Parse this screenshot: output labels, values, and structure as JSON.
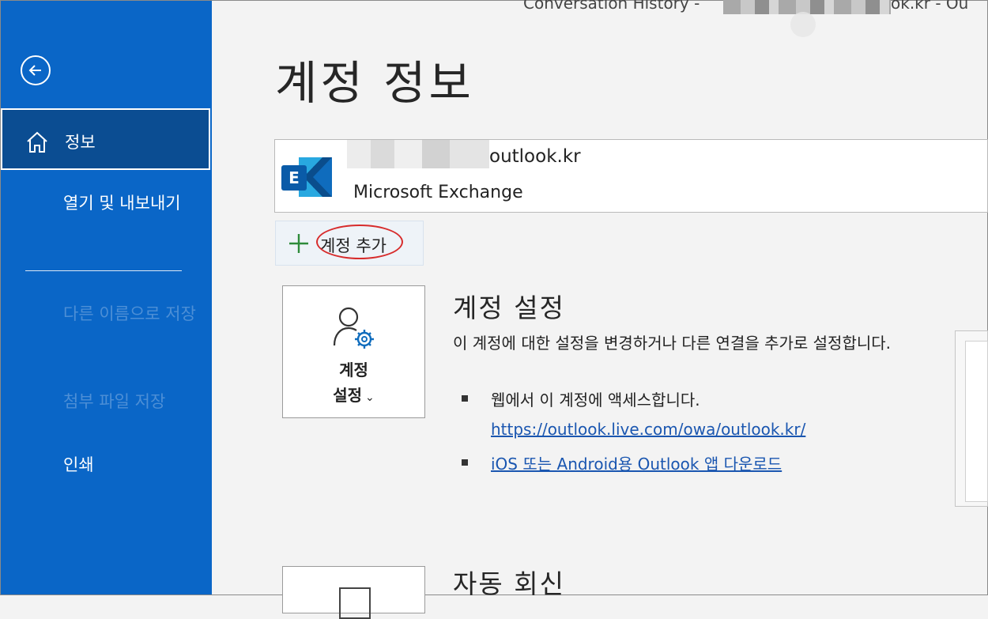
{
  "window": {
    "title": "Conversation History -",
    "title_suffix": "ok.kr  -  Ou"
  },
  "sidebar": {
    "back_icon": "back-arrow-circle-icon",
    "items": [
      {
        "label": "정보",
        "icon": "home-icon",
        "selected": true
      },
      {
        "label": "열기 및 내보내기",
        "enabled": true
      },
      {
        "label": "다른 이름으로 저장",
        "enabled": false
      },
      {
        "label": "첨부 파일 저장",
        "enabled": false
      },
      {
        "label": "인쇄",
        "enabled": true
      }
    ]
  },
  "main": {
    "title": "계정 정보",
    "account": {
      "email_visible": "outlook.kr",
      "type": "Microsoft Exchange",
      "icon": "exchange-icon"
    },
    "add_account": {
      "label": "계정 추가",
      "icon": "plus-icon"
    },
    "account_settings": {
      "tile_line1": "계정",
      "tile_line2": "설정",
      "dropdown_glyph": "⌄",
      "icon": "person-gear-icon",
      "title": "계정 설정",
      "description": "이 계정에 대한 설정을 변경하거나 다른 연결을 추가로 설정합니다.",
      "bullets": [
        {
          "text": "웹에서 이 계정에 액세스합니다."
        },
        {
          "link": "https://outlook.live.com/owa/outlook.kr/"
        },
        {
          "link": "iOS 또는 Android용 Outlook 앱 다운로드"
        }
      ]
    },
    "auto_reply": {
      "title": "자동 회신"
    }
  },
  "colors": {
    "sidebar_bg": "#0a66c7",
    "sidebar_selected": "#0b4d92",
    "link": "#1a56b0",
    "highlight_circle": "#d72c2c",
    "plus_green": "#2e8b3a"
  }
}
